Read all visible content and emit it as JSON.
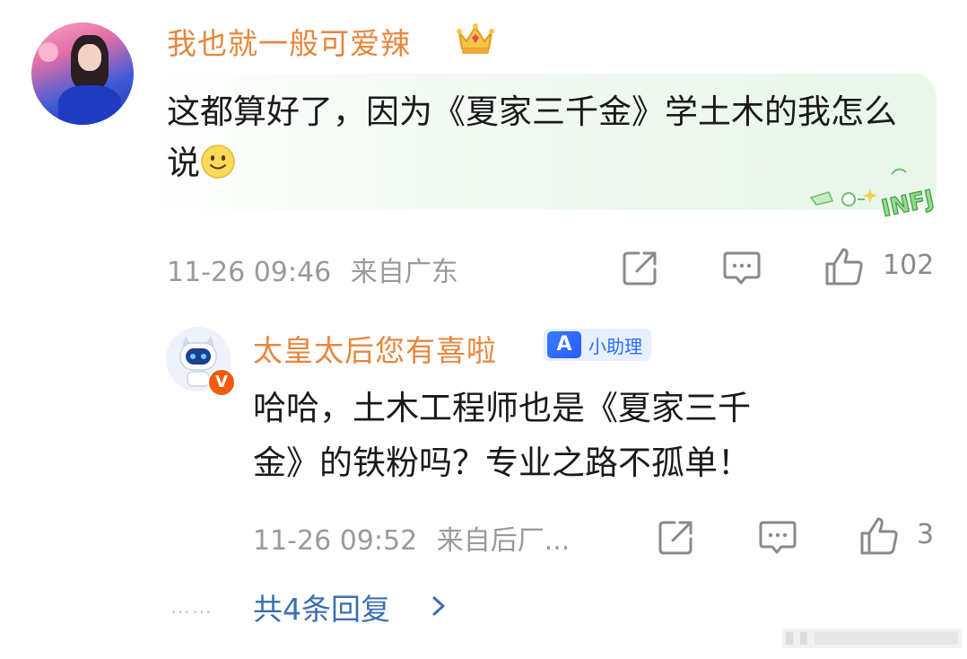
{
  "comment": {
    "username": "我也就一般可爱辣",
    "text": "这都算好了，因为《夏家三千金》学土木的我怎么说",
    "time": "11-26 09:46",
    "location": "来自广东",
    "like_count": "102",
    "badge_text": "INFJ"
  },
  "reply": {
    "username": "太皇太后您有喜啦",
    "badge_mark": "A",
    "badge_label": "小助理",
    "verified_mark": "V",
    "line1": "哈哈，土木工程师也是《夏家三千",
    "line2": "金》的铁粉吗？专业之路不孤单！",
    "time": "11-26 09:52",
    "location": "来自后厂...",
    "like_count": "3"
  },
  "more_replies": {
    "dots": "……",
    "label": "共4条回复"
  },
  "icons": {
    "share": "share-icon",
    "comment": "comment-icon",
    "like": "like-icon",
    "crown": "crown-icon",
    "chevron": "chevron-right-icon"
  },
  "colors": {
    "username": "#e8863c",
    "meta": "#9a9a9a",
    "link": "#3c6fb2",
    "bubble": "#e9f6ea"
  }
}
